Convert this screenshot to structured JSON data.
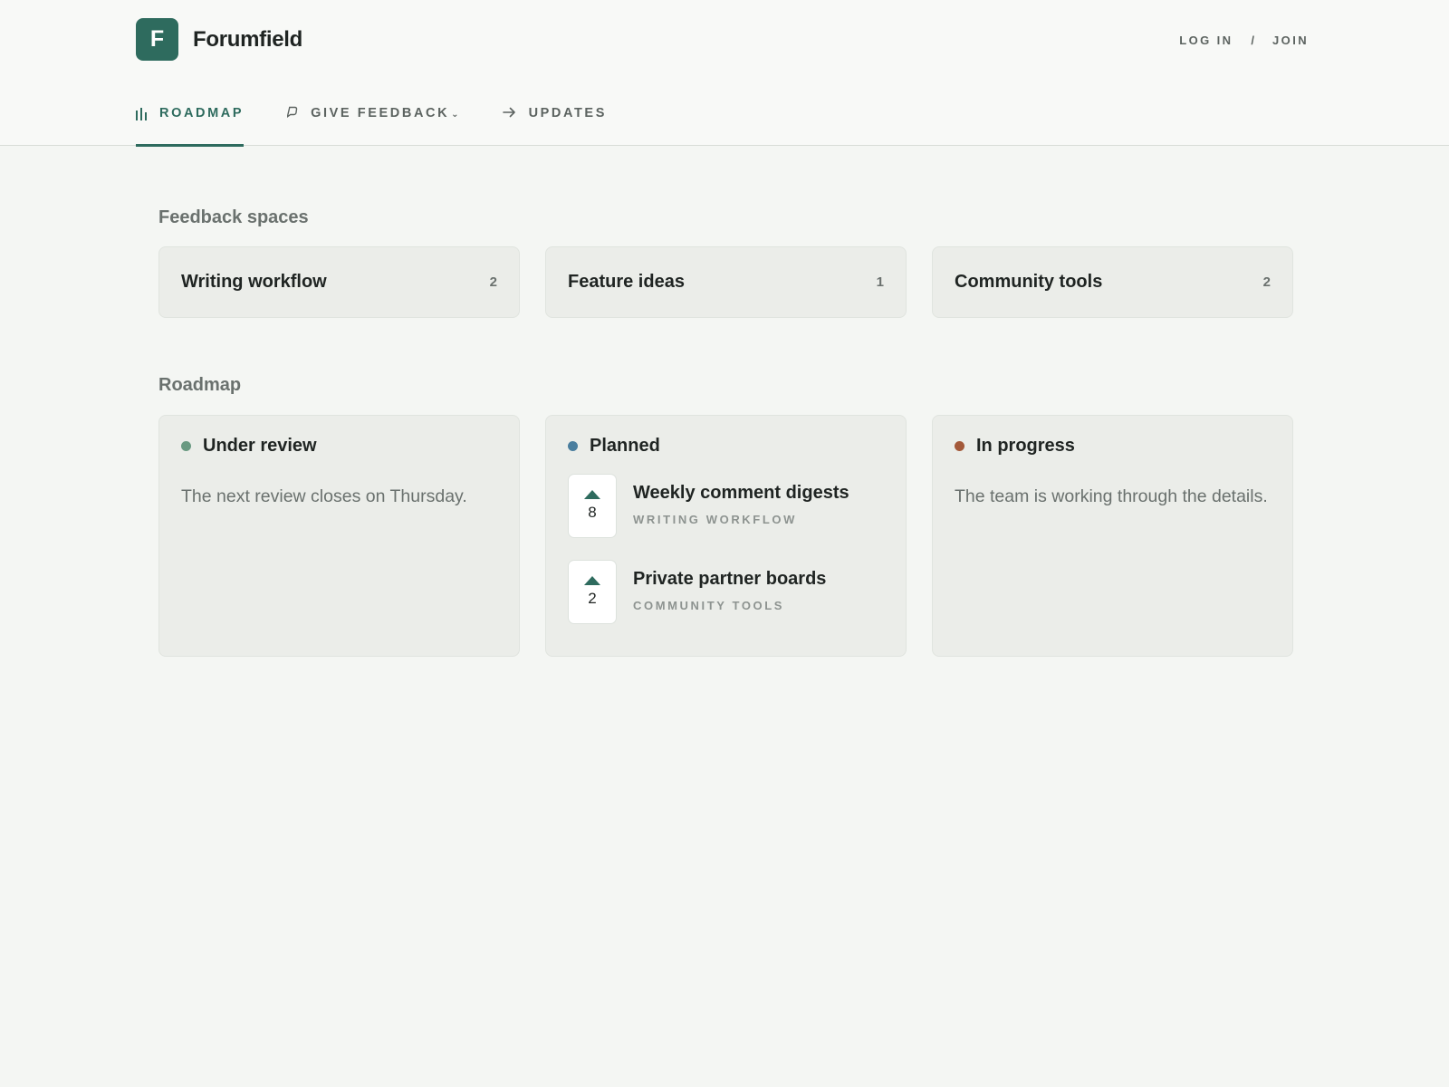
{
  "brand": {
    "logo_letter": "F",
    "name": "Forumfield"
  },
  "auth": {
    "login": "LOG IN",
    "separator": "/",
    "join": "JOIN"
  },
  "nav": {
    "tabs": [
      {
        "label": "ROADMAP",
        "icon": "bar-chart-icon",
        "active": true
      },
      {
        "label": "GIVE FEEDBACK",
        "icon": "speech-bubble-icon",
        "caret": "⌄"
      },
      {
        "label": "UPDATES",
        "icon": "arrow-right-icon"
      }
    ]
  },
  "feedback_spaces": {
    "title": "Feedback spaces",
    "items": [
      {
        "name": "Writing workflow",
        "count": "2"
      },
      {
        "name": "Feature ideas",
        "count": "1"
      },
      {
        "name": "Community tools",
        "count": "2"
      }
    ]
  },
  "roadmap": {
    "title": "Roadmap",
    "columns": [
      {
        "title": "Under review",
        "color": "#6a9a82",
        "text": "The next review closes on Thursday."
      },
      {
        "title": "Planned",
        "color": "#4a7e9e",
        "items": [
          {
            "title": "Weekly comment digests",
            "space": "WRITING WORKFLOW",
            "votes": "8"
          },
          {
            "title": "Private partner boards",
            "space": "COMMUNITY TOOLS",
            "votes": "2"
          }
        ]
      },
      {
        "title": "In progress",
        "color": "#a3593a",
        "text": "The team is working through the details."
      }
    ]
  },
  "colors": {
    "accent": "#2e6b5e",
    "background": "#f4f6f3",
    "card": "#ebede9"
  }
}
